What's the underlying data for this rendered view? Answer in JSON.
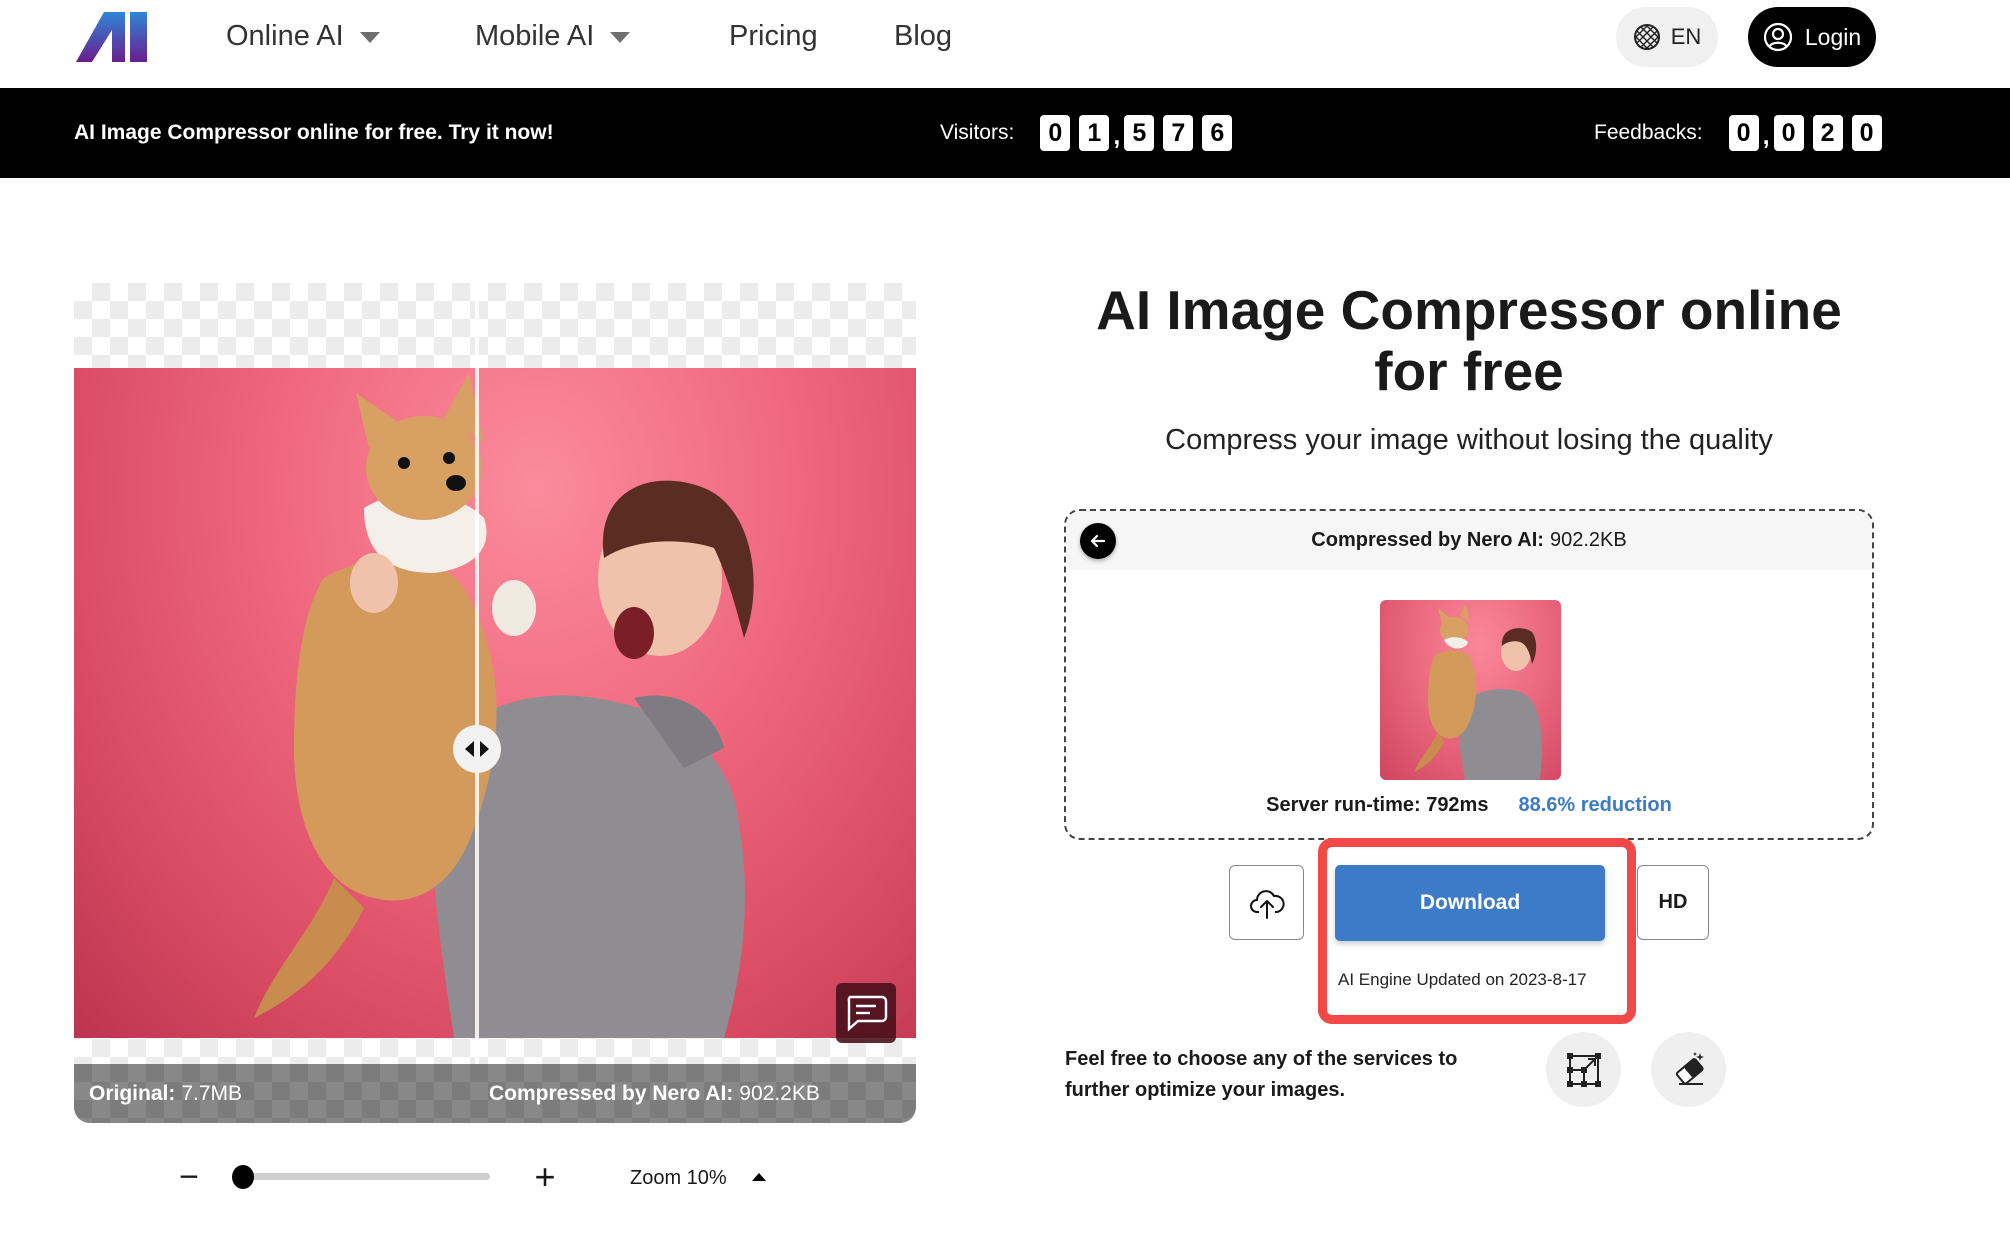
{
  "header": {
    "logo_text": "AI",
    "nav": [
      {
        "label": "Online AI",
        "has_dropdown": true
      },
      {
        "label": "Mobile AI",
        "has_dropdown": true
      },
      {
        "label": "Pricing",
        "has_dropdown": false
      },
      {
        "label": "Blog",
        "has_dropdown": false
      }
    ],
    "language": {
      "label": "EN",
      "icon": "globe-icon"
    },
    "login": {
      "label": "Login",
      "icon": "user-circle-icon"
    }
  },
  "banner": {
    "text": "AI Image Compressor online for free. Try it now!",
    "visitors": {
      "label": "Visitors:",
      "digits": [
        "0",
        "1",
        ",",
        "5",
        "7",
        "6"
      ],
      "value": "01,576"
    },
    "feedbacks": {
      "label": "Feedbacks:",
      "digits": [
        "0",
        ",",
        "0",
        "2",
        "0"
      ],
      "value": "0,020"
    }
  },
  "viewer": {
    "original_label": "Original:",
    "original_size": "7.7MB",
    "compressed_label": "Compressed by Nero AI:",
    "compressed_size": "902.2KB",
    "split_position": 0.48,
    "handle_icon": "split-arrows-icon",
    "chat_icon": "chat-icon"
  },
  "zoom": {
    "minus": "−",
    "plus": "+",
    "label": "Zoom 10%",
    "value_percent": 10
  },
  "main": {
    "title": "AI Image Compressor online for free",
    "subtitle": "Compress your image without losing the quality",
    "result": {
      "header_label": "Compressed by Nero AI:",
      "header_size": "902.2KB",
      "runtime": "Server run-time: 792ms",
      "reduction": "88.6% reduction"
    },
    "download_label": "Download",
    "hd_label": "HD",
    "engine_note": "AI Engine Updated on 2023-8-17",
    "services_text": "Feel free to choose any of the services to further optimize your images."
  },
  "colors": {
    "accent_blue": "#3b7bc8",
    "highlight_red": "#f24848",
    "banner_bg": "#000000",
    "logo_gradient": [
      "#2f86d6",
      "#6a1d8f"
    ]
  }
}
